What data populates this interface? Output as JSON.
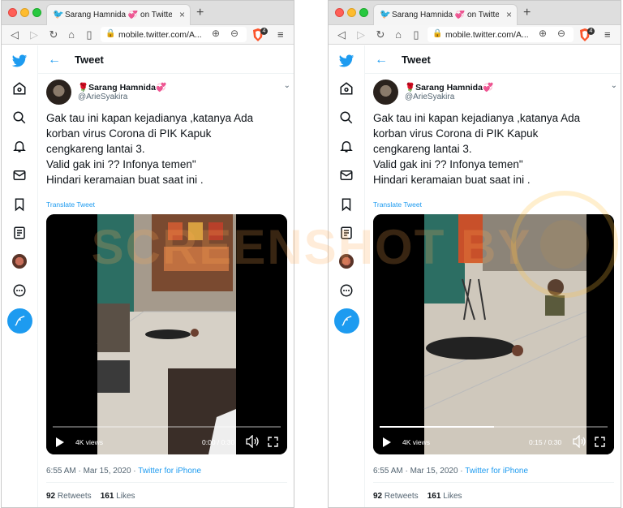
{
  "browser": {
    "tab_title": "Sarang Hamnida 💞 on Twitter",
    "tab_close": "×",
    "new_tab": "+",
    "url": "mobile.twitter.com/A..."
  },
  "header": {
    "title": "Tweet"
  },
  "author": {
    "display_name": "Sarang Hamnida",
    "handle": "@ArieSyakira"
  },
  "tweet": {
    "lines": [
      "Gak tau ini kapan kejadianya ,katanya Ada",
      "korban virus Corona di PIK Kapuk",
      "cengkareng lantai 3.",
      "Valid gak ini ?? Infonya temen\"",
      "Hindari keramaian buat saat ini ."
    ],
    "translate": "Translate Tweet"
  },
  "videos": {
    "left": {
      "views": "4K views",
      "time": "0:00 / 0:30",
      "progress": 0.0
    },
    "right": {
      "views": "4K views",
      "time": "0:15 / 0:30",
      "progress": 0.5
    }
  },
  "meta": {
    "timestamp": "6:55 AM · Mar 15, 2020",
    "source": "Twitter for iPhone"
  },
  "stats": {
    "retweets": "92",
    "retweets_label": "Retweets",
    "likes": "161",
    "likes_label": "Likes"
  },
  "overlay": {
    "watermark": "SCREENSHOT BY"
  },
  "colors": {
    "accent": "#1d9bf0",
    "text": "#0f1419",
    "secondary": "#536471"
  }
}
